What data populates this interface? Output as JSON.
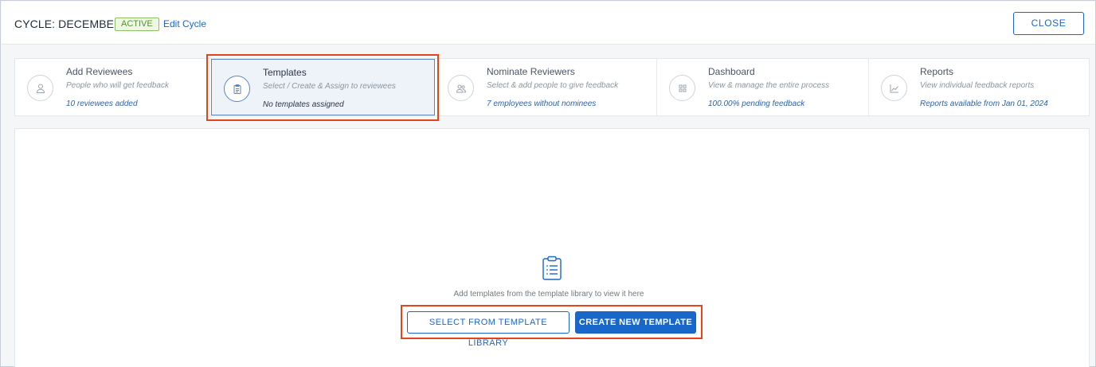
{
  "header": {
    "cycle_title": "CYCLE: DECEMBER",
    "status_badge": "ACTIVE",
    "edit_link": "Edit Cycle",
    "close_label": "CLOSE"
  },
  "steps": [
    {
      "name": "Add Reviewees",
      "description": "People who will get feedback",
      "status": "10  reviewees added",
      "icon": "person-icon"
    },
    {
      "name": "Templates",
      "description": "Select / Create & Assign to reviewees",
      "status": "No templates assigned",
      "icon": "clipboard-icon",
      "selected": true
    },
    {
      "name": "Nominate Reviewers",
      "description": "Select & add people to give feedback",
      "status": "7  employees without nominees",
      "icon": "people-icon"
    },
    {
      "name": "Dashboard",
      "description": "View & manage the entire process",
      "status": "100.00% pending feedback",
      "icon": "grid-icon"
    },
    {
      "name": "Reports",
      "description": "View individual feedback reports",
      "status": "Reports available from Jan 01, 2024",
      "icon": "chart-icon"
    }
  ],
  "empty_state": {
    "icon": "clipboard-list-icon",
    "message": "Add templates from the template library to view it here",
    "library_button": "SELECT FROM TEMPLATE LIBRARY",
    "create_button": "CREATE NEW TEMPLATE"
  },
  "colors": {
    "accent": "#1967c9",
    "highlight": "#e2441b",
    "badge_green": "#8cc063"
  }
}
